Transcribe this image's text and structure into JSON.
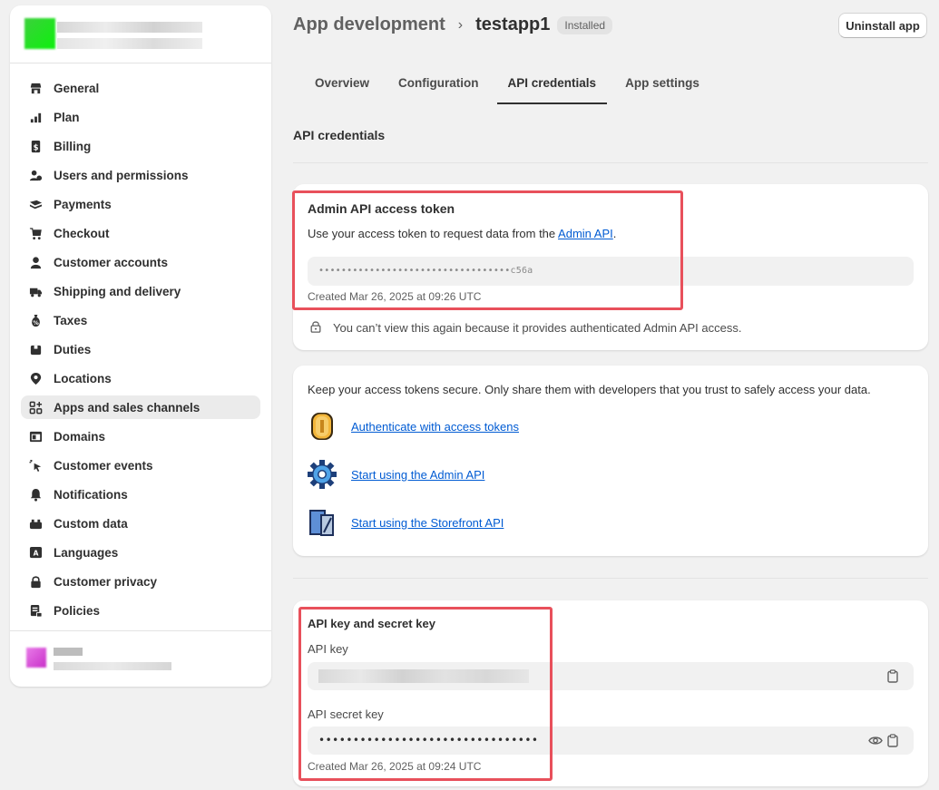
{
  "header": {
    "parent": "App development",
    "separator": "›",
    "title": "testapp1",
    "badge": "Installed",
    "uninstall_label": "Uninstall app"
  },
  "tabs": [
    {
      "label": "Overview"
    },
    {
      "label": "Configuration"
    },
    {
      "label": "API credentials",
      "active": true
    },
    {
      "label": "App settings"
    }
  ],
  "section_title": "API credentials",
  "sidebar": {
    "items": [
      {
        "label": "General",
        "icon": "store-icon"
      },
      {
        "label": "Plan",
        "icon": "chart-icon"
      },
      {
        "label": "Billing",
        "icon": "receipt-icon"
      },
      {
        "label": "Users and permissions",
        "icon": "users-icon"
      },
      {
        "label": "Payments",
        "icon": "payment-icon"
      },
      {
        "label": "Checkout",
        "icon": "cart-icon"
      },
      {
        "label": "Customer accounts",
        "icon": "person-icon"
      },
      {
        "label": "Shipping and delivery",
        "icon": "truck-icon"
      },
      {
        "label": "Taxes",
        "icon": "tax-icon"
      },
      {
        "label": "Duties",
        "icon": "box-icon"
      },
      {
        "label": "Locations",
        "icon": "location-icon"
      },
      {
        "label": "Apps and sales channels",
        "icon": "apps-icon",
        "active": true
      },
      {
        "label": "Domains",
        "icon": "globe-icon"
      },
      {
        "label": "Customer events",
        "icon": "cursor-icon"
      },
      {
        "label": "Notifications",
        "icon": "bell-icon"
      },
      {
        "label": "Custom data",
        "icon": "database-icon"
      },
      {
        "label": "Languages",
        "icon": "language-icon"
      },
      {
        "label": "Customer privacy",
        "icon": "lock-icon"
      },
      {
        "label": "Policies",
        "icon": "policy-icon"
      }
    ]
  },
  "admin_token": {
    "title": "Admin API access token",
    "desc_prefix": "Use your access token to request data from the ",
    "desc_link": "Admin API",
    "desc_suffix": ".",
    "token_masked": "••••••••••••••••••••••••••••••••••c56a",
    "created": "Created Mar 26, 2025 at 09:26 UTC",
    "warning": "You can’t view this again because it provides authenticated Admin API access."
  },
  "resources": {
    "intro": "Keep your access tokens secure. Only share them with developers that you trust to safely access your data.",
    "links": [
      {
        "label": "Authenticate with access tokens",
        "icon": "coin-icon"
      },
      {
        "label": "Start using the Admin API",
        "icon": "gear-icon"
      },
      {
        "label": "Start using the Storefront API",
        "icon": "storefront-doc-icon"
      }
    ]
  },
  "api_keys": {
    "title": "API key and secret key",
    "api_key_label": "API key",
    "secret_label": "API secret key",
    "secret_masked": "••••••••••••••••••••••••••••••••",
    "created": "Created Mar 26, 2025 at 09:24 UTC"
  },
  "colors": {
    "accent_link": "#005bd3",
    "highlight": "#e8505b",
    "background": "#f1f1f1"
  }
}
